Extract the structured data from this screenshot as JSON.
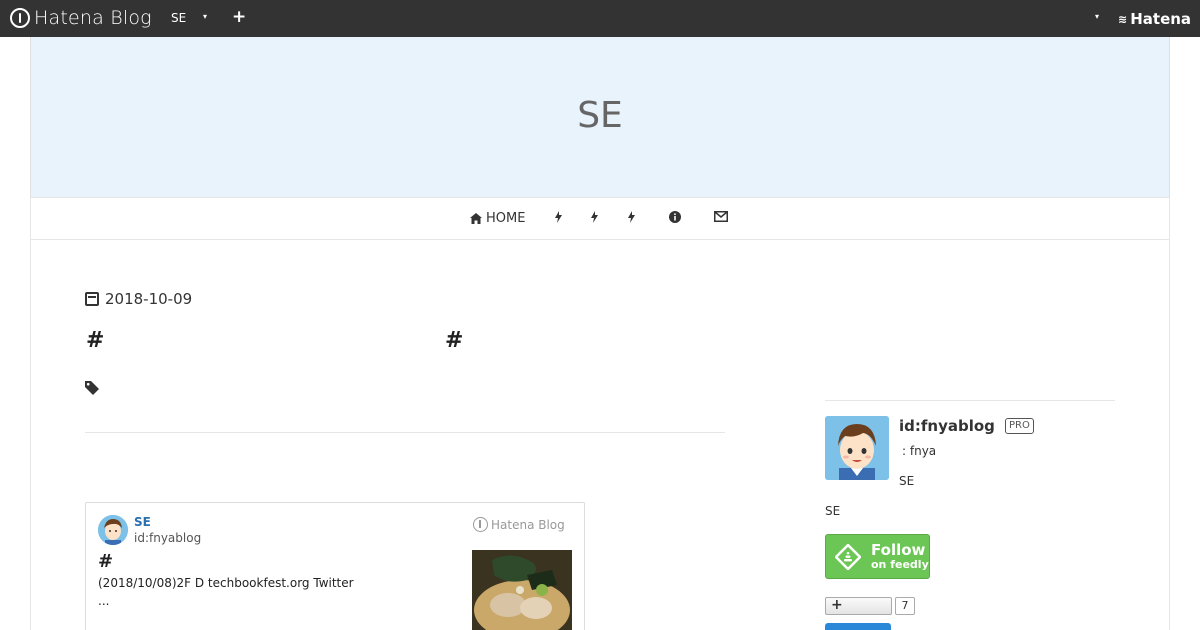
{
  "topbar": {
    "logo_text": "Hatena Blog",
    "blog_name": "SE",
    "caret": "▾",
    "plus": "+",
    "caret_right": "▾",
    "brand": "Hatena"
  },
  "banner": {
    "title": "SE"
  },
  "nav": {
    "items": [
      {
        "label": "HOME",
        "icon": "home-icon"
      },
      {
        "label": "",
        "icon": "bolt-icon"
      },
      {
        "label": "",
        "icon": "bolt-icon"
      },
      {
        "label": "",
        "icon": "bolt-icon"
      },
      {
        "label": "",
        "icon": "info-icon"
      },
      {
        "label": "",
        "icon": "mail-icon"
      }
    ]
  },
  "article": {
    "date": "2018-10-09",
    "heading_mark_1": "#",
    "heading_mark_2": "#"
  },
  "embed_card": {
    "blog_title": "SE",
    "blog_id": "id:fnyablog",
    "brand": "Hatena Blog",
    "heading_mark": "#",
    "description": "(2018/10/08)2F D techbookfest.org  Twitter",
    "ellipsis": "..."
  },
  "sidebar": {
    "user_id": "id:fnyablog",
    "badge": "PRO",
    "name_line": ": fnya",
    "line1": "SE",
    "line2": "SE",
    "feedly_follow": "Follow",
    "feedly_on": "on feedly",
    "subscribe_plus": "+",
    "subscribe_count": "7"
  },
  "colors": {
    "topbar_bg": "#333333",
    "banner_bg": "#e8f3fc",
    "feedly_green": "#6cc655",
    "link_blue": "#2a6fb0"
  }
}
